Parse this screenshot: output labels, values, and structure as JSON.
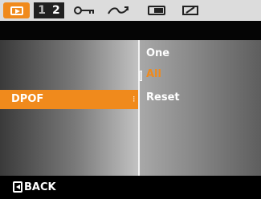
{
  "tabs": {
    "play_icon": "playback-icon",
    "numbers": [
      "1",
      "2"
    ],
    "icons": [
      "protect-key-icon",
      "rotate-icon",
      "playback-effect-icon",
      "edit-icon"
    ]
  },
  "menu": {
    "selected_item": "DPOF",
    "options": [
      "One",
      "All",
      "Reset"
    ],
    "highlighted_option": "All"
  },
  "footer": {
    "back_label": "BACK"
  },
  "colors": {
    "accent": "#f08a1c",
    "tabbar_bg": "#dcdcdc"
  }
}
